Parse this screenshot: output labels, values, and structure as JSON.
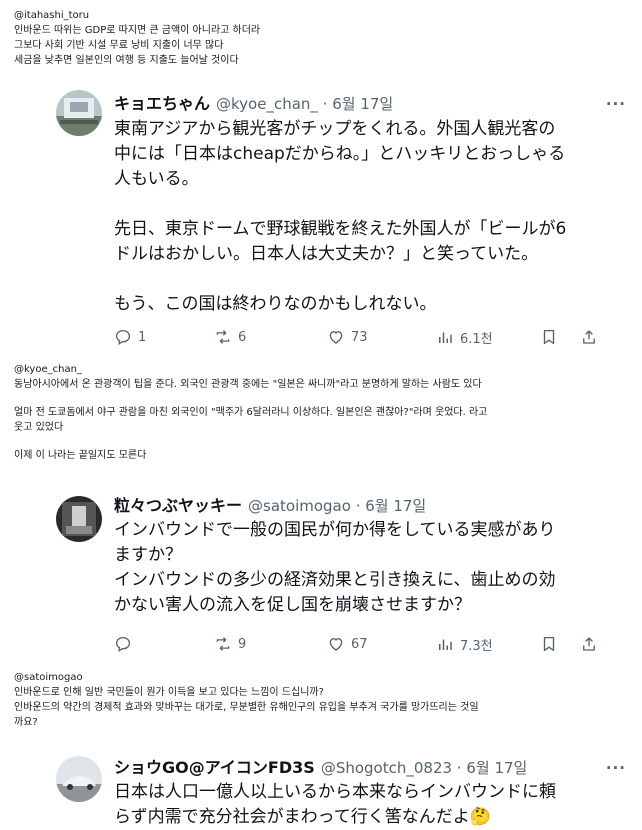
{
  "note1": {
    "lines": [
      "@itahashi_toru",
      "인바운드 따위는 GDP로 따지면 큰 금액이 아니라고 하더라",
      "그보다 사회 기반 시설 무료 낭비 지출이 너무 많다",
      "세금을 낮추면 일본인의 여행 등 지출도 늘어날 것이다"
    ]
  },
  "tweet1": {
    "name": "キョエちゃん",
    "handle": "@kyoe_chan_ · 6월 17일",
    "more": "···",
    "lines": [
      "東南アジアから観光客がチップをくれる。外国人観光客の",
      "中には「日本はcheapだからね。」とハッキリとおっしゃる",
      "人もいる。",
      "",
      "先日、東京ドームで野球観戦を終えた外国人が「ビールが6",
      "ドルはおかしい。日本人は大丈夫か？」と笑っていた。",
      "",
      "もう、この国は終わりなのかもしれない。"
    ],
    "stats": {
      "replies": "1",
      "retweets": "6",
      "likes": "73",
      "views": "6.1천"
    }
  },
  "note2": {
    "lines": [
      "@kyoe_chan_",
      "동남아시아에서 온 관광객이 팁을 준다. 외국인 관광객 중에는 \"일본은 싸니까\"라고 분명하게 말하는 사람도 있다",
      "",
      "얼마 전 도쿄돔에서 야구 관람을 마친 외국인이 \"맥주가 6달러라니 이상하다. 일본인은 괜찮아?\"라며 웃었다. 라고",
      "웃고 있었다",
      "",
      "이제 이 나라는 끝일지도 모른다"
    ]
  },
  "tweet2": {
    "name": "粒々つぶヤッキー",
    "handle": "@satoimogao · 6월 17일",
    "lines": [
      "インバウンドで一般の国民が何か得をしている実感があり",
      "ますか？",
      "インバウンドの多少の経済効果と引き換えに、歯止めの効",
      "かない害人の流入を促し国を崩壊させますか？"
    ],
    "stats": {
      "replies": "",
      "retweets": "9",
      "likes": "67",
      "views": "7.3천"
    }
  },
  "note3": {
    "lines": [
      "@satoimogao",
      "인바운드로 인해 일반 국민들이 뭔가 이득을 보고 있다는 느낌이 드십니까?",
      "인바운드의 약간의 경제적 효과와 맞바꾸는 대가로, 무분별한 유해인구의 유입을 부추겨 국가를 망가뜨리는 것일",
      "까요?"
    ]
  },
  "tweet3": {
    "name": "ショウGO@アイコンFD3S",
    "handle": "@Shogotch_0823 · 6월 17일",
    "more": "···",
    "lines": [
      "日本は人口一億人以上いるから本来ならインバウンドに頼",
      "らず内需で充分社会がまわって行く筈なんだよ"
    ],
    "emoji": "🤔"
  },
  "colors": {
    "text": "#0f1419",
    "muted": "#536471",
    "bg": "#ffffff"
  }
}
